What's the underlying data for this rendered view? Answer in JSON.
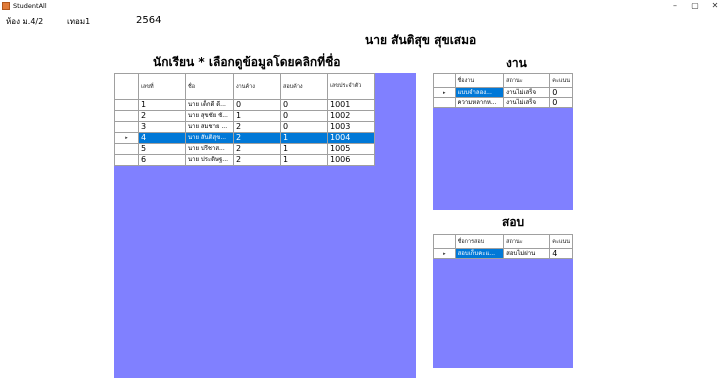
{
  "window": {
    "title": "StudentAll"
  },
  "info": {
    "room": "ห้อง ม.4/2",
    "term": "เทอม1",
    "year": "2564"
  },
  "student_name": "นาย สันติสุข สุขเสมอ",
  "students_heading": "นักเรียน * เลือกดูข้อมูลโดยคลิกที่ชื่อ",
  "work_heading": "งาน",
  "exam_heading": "สอบ",
  "students_grid": {
    "columns": [
      "เลขที่",
      "ชื่อ",
      "งานค้าง",
      "สอบค้าง",
      "เลขประจำตัว"
    ],
    "rows": [
      [
        "1",
        "นาย เด็กดี ดี...",
        "0",
        "0",
        "1001"
      ],
      [
        "2",
        "นาย สุขชัย ชั...",
        "1",
        "0",
        "1002"
      ],
      [
        "3",
        "นาย สมชาย ...",
        "2",
        "0",
        "1003"
      ],
      [
        "4",
        "นาย สันติสุข...",
        "2",
        "1",
        "1004"
      ],
      [
        "5",
        "นาย ปรีชาส...",
        "2",
        "1",
        "1005"
      ],
      [
        "6",
        "นาย ประดิษฐ...",
        "2",
        "1",
        "1006"
      ]
    ],
    "selected_row": 3
  },
  "work_grid": {
    "columns": [
      "ชื่องาน",
      "สถานะ",
      "คะแนน"
    ],
    "rows": [
      [
        "แบบจำลอง...",
        "งานไม่เสร็จ",
        "0"
      ],
      [
        "ความหลากห...",
        "งานไม่เสร็จ",
        "0"
      ]
    ]
  },
  "exam_grid": {
    "columns": [
      "ชื่อการสอบ",
      "สถานะ",
      "คะแนน"
    ],
    "rows": [
      [
        "สอบเก็บคะแ...",
        "สอบไม่ผ่าน",
        "4"
      ]
    ]
  },
  "colors": {
    "grid_background": "#8080ff",
    "selection": "#0078d7"
  }
}
